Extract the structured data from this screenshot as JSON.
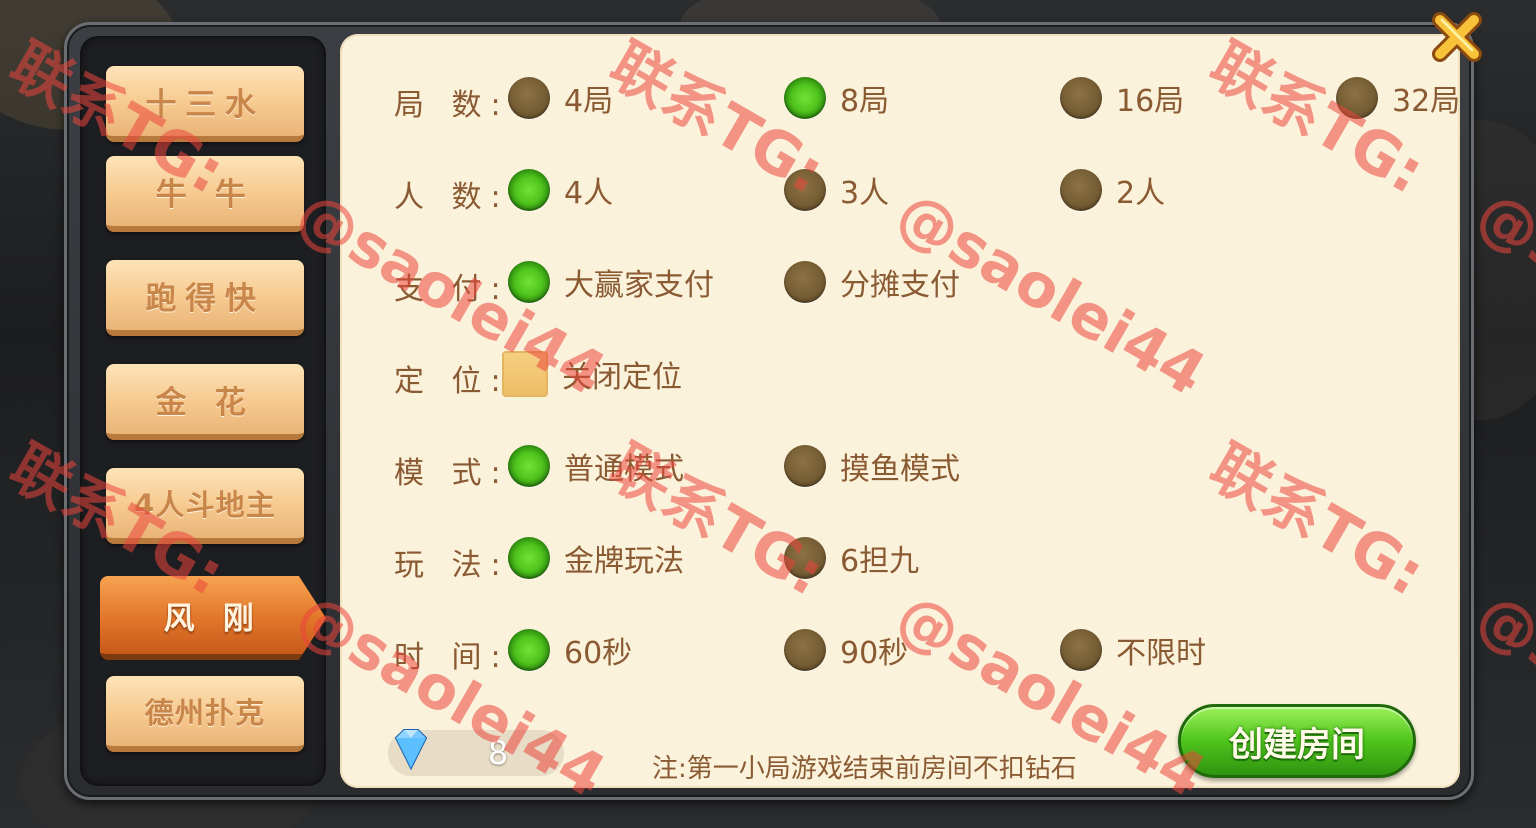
{
  "sidebar": {
    "tabs": [
      {
        "label": "十三水"
      },
      {
        "label": "牛 牛"
      },
      {
        "label": "跑得快"
      },
      {
        "label": "金 花"
      },
      {
        "label": "4人斗地主"
      },
      {
        "label": "风 刚",
        "active": true
      },
      {
        "label": "德州扑克"
      }
    ]
  },
  "settings": {
    "rounds": {
      "label": "局 数:",
      "options": [
        "4局",
        "8局",
        "16局",
        "32局"
      ],
      "selected": "8局"
    },
    "players": {
      "label": "人 数:",
      "options": [
        "4人",
        "3人",
        "2人"
      ],
      "selected": "4人"
    },
    "payment": {
      "label": "支 付:",
      "options": [
        "大赢家支付",
        "分摊支付"
      ],
      "selected": "大赢家支付"
    },
    "location": {
      "label": "定 位:",
      "option": "关闭定位",
      "checked": false
    },
    "mode": {
      "label": "模 式:",
      "options": [
        "普通模式",
        "摸鱼模式"
      ],
      "selected": "普通模式"
    },
    "play": {
      "label": "玩 法:",
      "options": [
        "金牌玩法",
        "6担九"
      ],
      "selected": "金牌玩法"
    },
    "time": {
      "label": "时 间:",
      "options": [
        "60秒",
        "90秒",
        "不限时"
      ],
      "selected": "60秒"
    }
  },
  "footer": {
    "diamonds": "8",
    "note": "注:第一小局游戏结束前房间不扣钻石",
    "create_label": "创建房间"
  },
  "watermark": {
    "line1": "联系TG:",
    "line2": "@saolei44"
  },
  "colors": {
    "panel_bg": "#fbf2dc",
    "text_brown": "#8a5a33",
    "radio_on": "#4fc41c",
    "radio_off": "#6f5730",
    "tab_active": "#e2762a",
    "watermark": "#eb463c"
  },
  "icons": [
    "close-icon",
    "diamond-icon"
  ]
}
